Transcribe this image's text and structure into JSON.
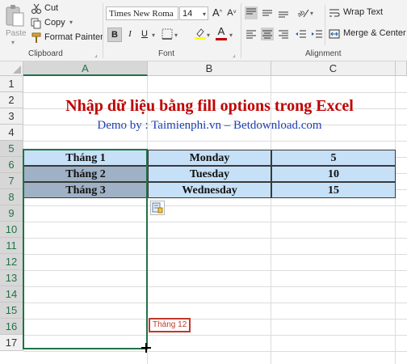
{
  "clipboard": {
    "paste_label": "Paste",
    "cut_label": "Cut",
    "copy_label": "Copy",
    "format_painter_label": "Format Painter",
    "group_label": "Clipboard"
  },
  "font": {
    "font_name": "Times New Roma",
    "font_size": "14",
    "grow_label": "A",
    "shrink_label": "A",
    "bold_label": "B",
    "italic_label": "I",
    "underline_label": "U",
    "font_color_label": "A",
    "group_label": "Font"
  },
  "alignment": {
    "wrap_text_label": "Wrap Text",
    "merge_center_label": "Merge & Center",
    "group_label": "Alignment"
  },
  "columns": [
    "A",
    "B",
    "C"
  ],
  "rows": [
    "1",
    "2",
    "3",
    "4",
    "5",
    "6",
    "7",
    "8",
    "9",
    "10",
    "11",
    "12",
    "13",
    "14",
    "15",
    "16",
    "17"
  ],
  "sheet": {
    "title": "Nhập dữ liệu bằng fill options trong Excel",
    "subtitle_prefix": "Demo by : ",
    "subtitle_site": "Taimienphi.vn – Betdownload.com",
    "table": [
      {
        "a": "Tháng 1",
        "b": "Monday",
        "c": "5"
      },
      {
        "a": "Tháng 2",
        "b": "Tuesday",
        "c": "10"
      },
      {
        "a": "Tháng 3",
        "b": "Wednesday",
        "c": "15"
      }
    ],
    "fill_tooltip": "Tháng 12"
  },
  "colors": {
    "accent_green": "#217346",
    "title_red": "#c00000",
    "subtitle_blue": "#1f3fb3",
    "table_fill": "#c6e0f7",
    "selection_fill": "#9fb1c4",
    "tooltip_red": "#c0392b"
  },
  "icons": [
    "scissors-icon",
    "copy-icon",
    "format-painter-icon",
    "paste-icon",
    "highlight-icon",
    "borders-icon",
    "orientation-icon",
    "wrap-text-icon",
    "merge-icon",
    "autofill-options-icon"
  ]
}
